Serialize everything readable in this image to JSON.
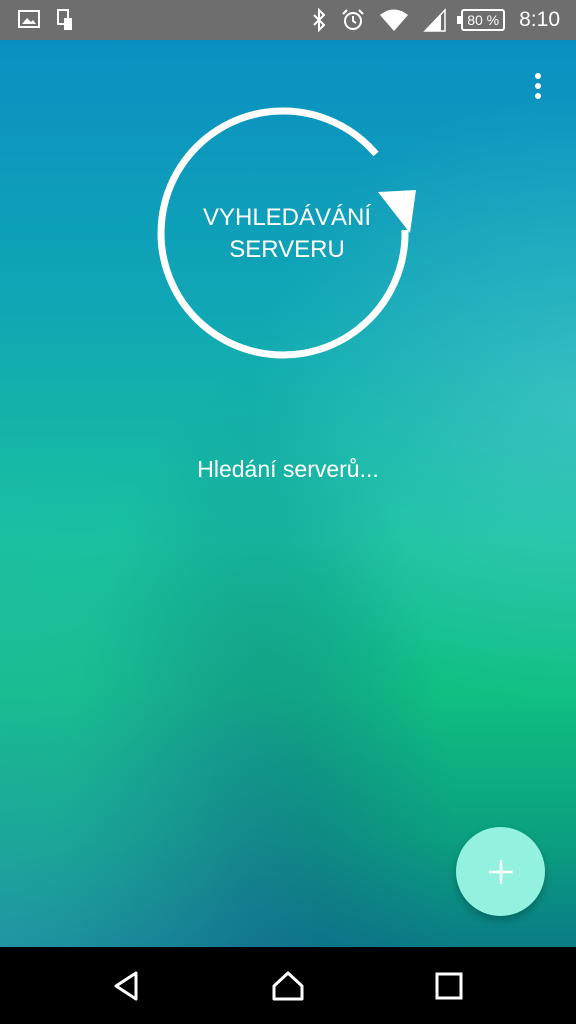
{
  "status_bar": {
    "icons_left": [
      "image-icon",
      "device-icon"
    ],
    "icons_right": [
      "bluetooth-icon",
      "alarm-icon",
      "wifi-icon",
      "signal-icon"
    ],
    "battery": "80 %",
    "time": "8:10"
  },
  "main": {
    "scan_button_label_line1": "VYHLEDÁVÁNÍ",
    "scan_button_label_line2": "SERVERU",
    "status_text": "Hledání serverů...",
    "menu_icon": "more-vert-icon",
    "fab_icon": "plus-icon"
  },
  "nav_bar": {
    "back_icon": "back-icon",
    "home_icon": "home-icon",
    "recents_icon": "recents-icon"
  },
  "colors": {
    "status_bar": "#6e6e6e",
    "gradient_top": "#0b8fc3",
    "gradient_mid": "#18c19e",
    "fab": "#92f2df",
    "text": "#ffffff"
  }
}
